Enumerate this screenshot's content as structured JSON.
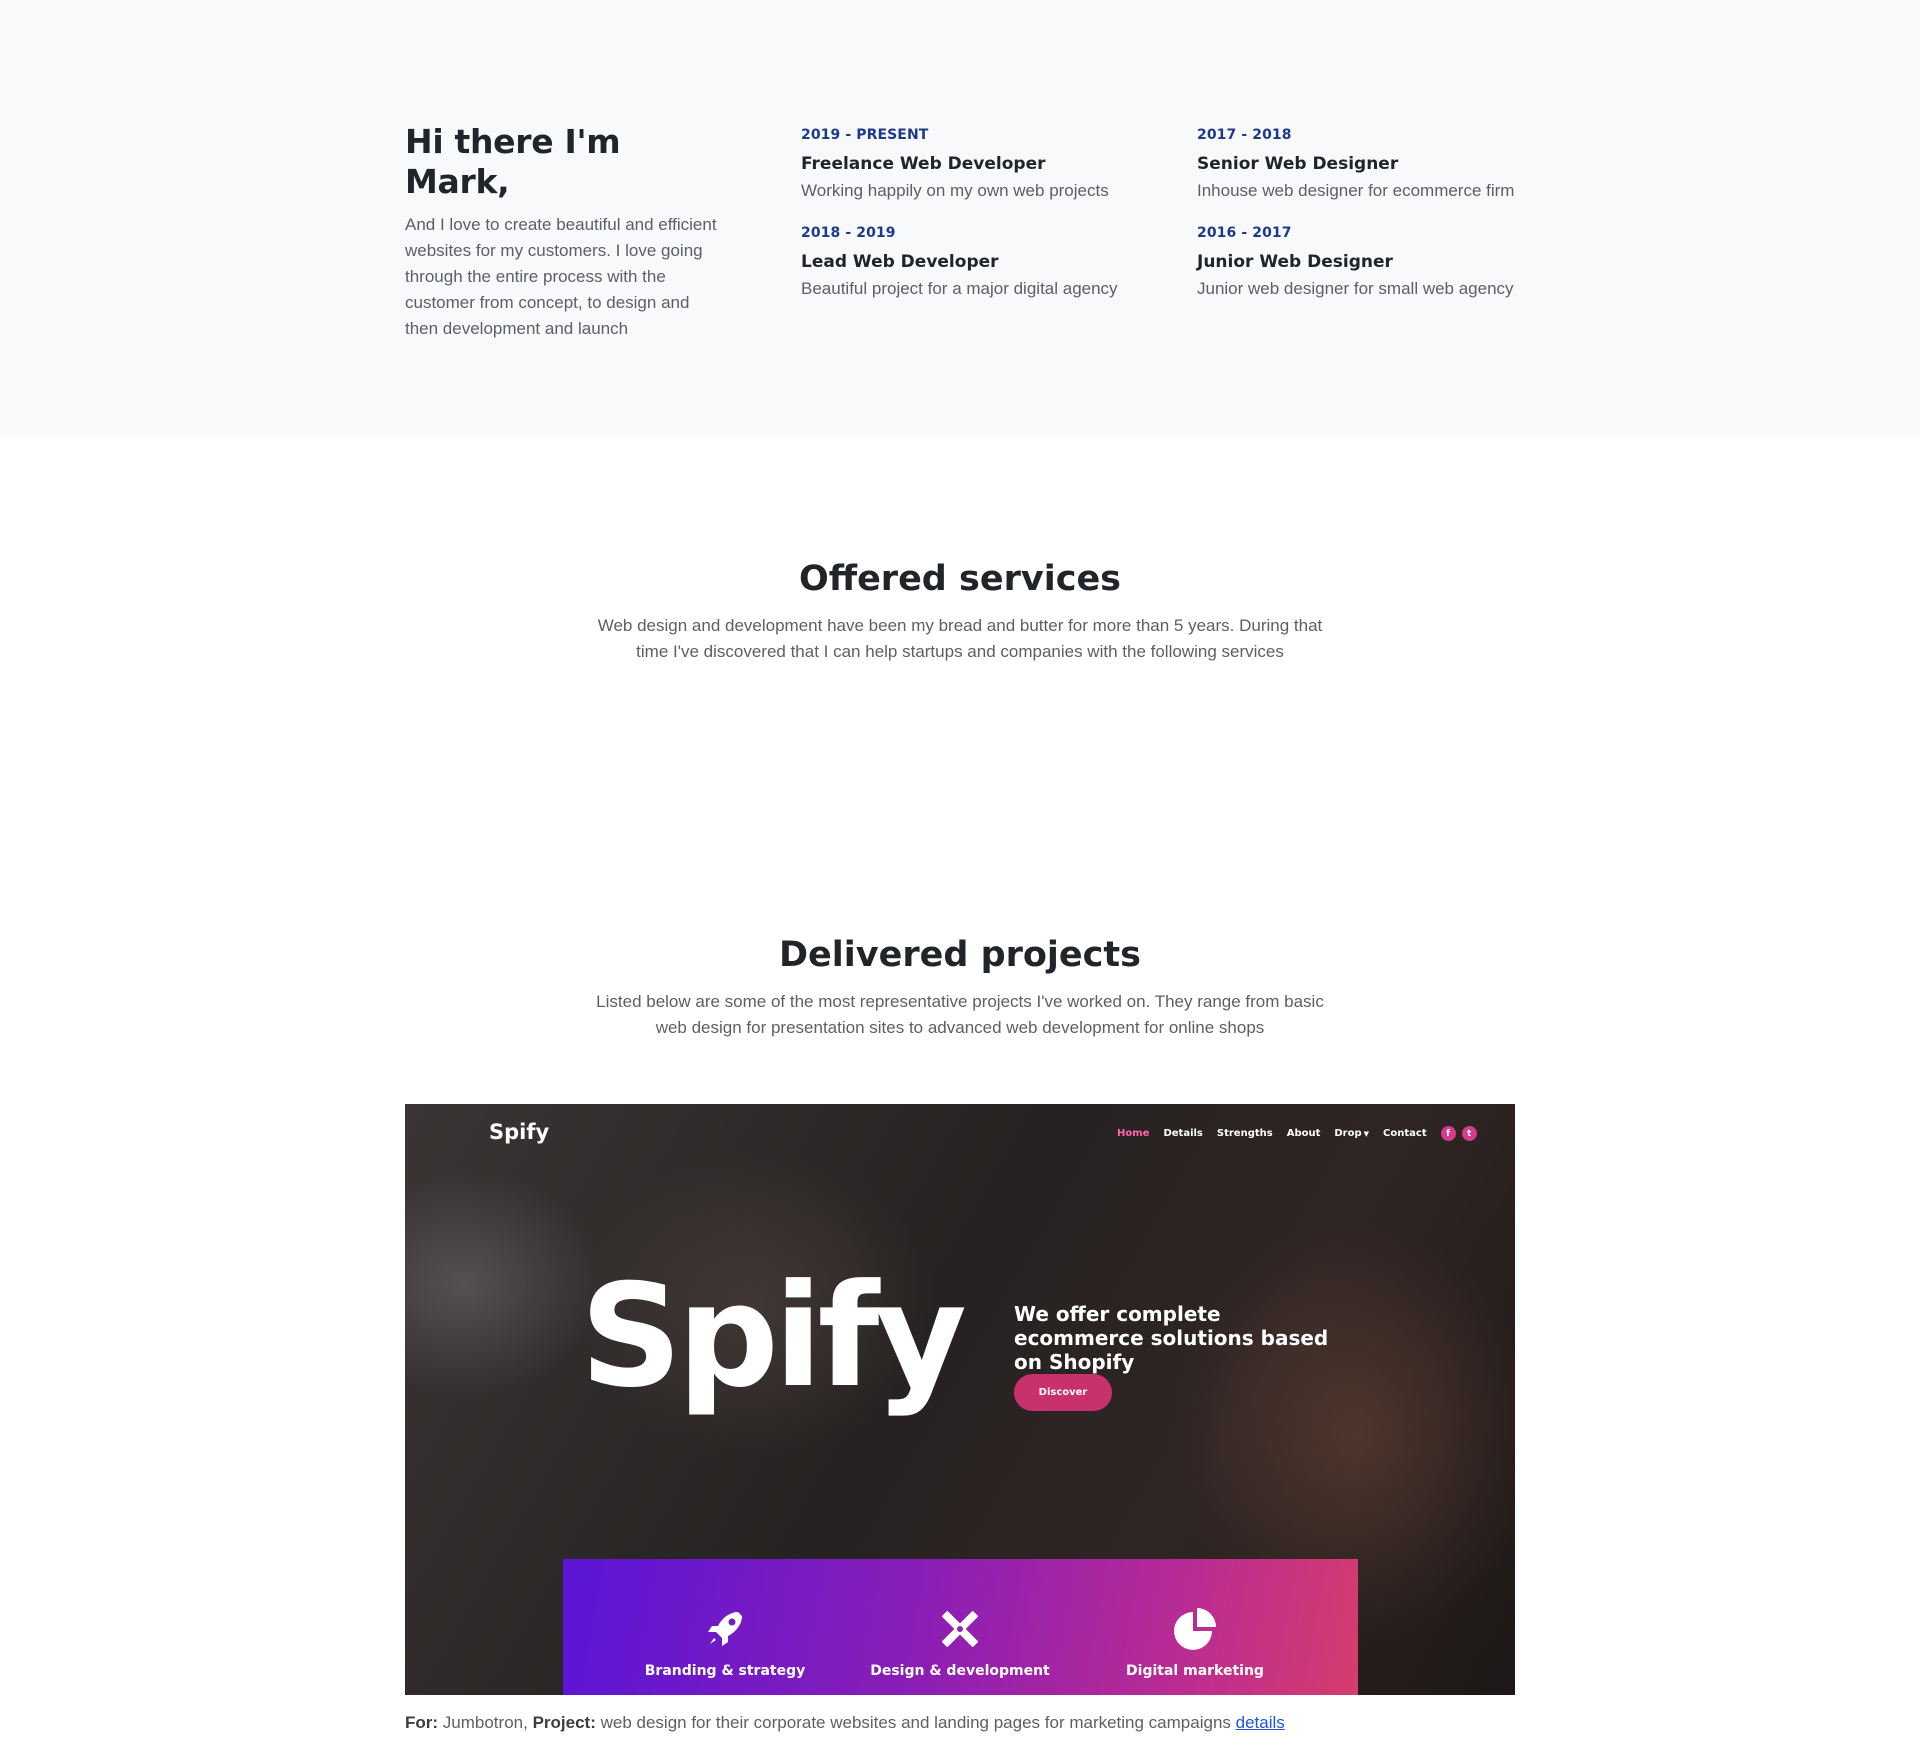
{
  "about": {
    "title": "Hi there I'm Mark,",
    "text": "And I love to create beautiful and efficient websites for my customers. I love going through the entire process with the customer from concept, to design and then development and launch",
    "timeline": [
      {
        "date": "2019 - PRESENT",
        "role": "Freelance Web Developer",
        "desc": "Working happily on my own web projects"
      },
      {
        "date": "2017 - 2018",
        "role": "Senior Web Designer",
        "desc": "Inhouse web designer for ecommerce firm"
      },
      {
        "date": "2018 - 2019",
        "role": "Lead Web Developer",
        "desc": "Beautiful project for a major digital agency"
      },
      {
        "date": "2016 - 2017",
        "role": "Junior Web Designer",
        "desc": "Junior web designer for small web agency"
      }
    ]
  },
  "services": {
    "title": "Offered services",
    "subtitle": "Web design and development have been my bread and butter for more than 5 years. During that time I've discovered that I can help startups and companies with the following services"
  },
  "projects": {
    "title": "Delivered projects",
    "subtitle": "Listed below are some of the most representative projects I've worked on. They range from basic web design for presentation sites to advanced web development for online shops",
    "showcase": {
      "logo": "Spify",
      "nav": [
        "Home",
        "Details",
        "Strengths",
        "About",
        "Drop",
        "Contact"
      ],
      "nav_active": "Home",
      "social_icons": [
        "facebook-icon",
        "twitter-icon"
      ],
      "hero_word": "Spify",
      "tagline": "We offer complete ecommerce solutions based on Shopify",
      "cta": "Discover",
      "features": [
        {
          "icon": "rocket-icon",
          "label": "Branding & strategy"
        },
        {
          "icon": "pencil-ruler-icon",
          "label": "Design & development"
        },
        {
          "icon": "pie-chart-icon",
          "label": "Digital marketing"
        }
      ],
      "accent_color": "#c8306e"
    },
    "caption": {
      "for_label": "For:",
      "client": "Jumbotron,",
      "project_label": "Project:",
      "description": "web design for their corporate websites and landing pages for marketing campaigns",
      "link": "details"
    }
  },
  "colors": {
    "date_accent": "#1d3a8a",
    "section_bg": "#f8f9fa",
    "link": "#1f55d6"
  }
}
